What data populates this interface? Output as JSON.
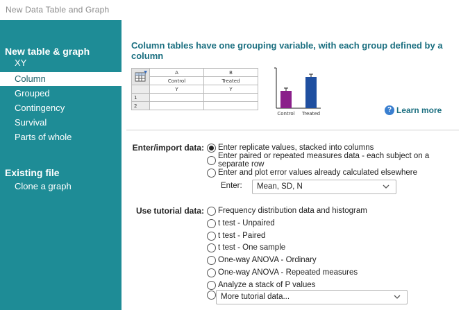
{
  "window": {
    "title": "New Data Table and Graph"
  },
  "sidebar": {
    "new_heading": "New table & graph",
    "items": [
      {
        "label": "XY",
        "selected": false
      },
      {
        "label": "Column",
        "selected": true
      },
      {
        "label": "Grouped",
        "selected": false
      },
      {
        "label": "Contingency",
        "selected": false
      },
      {
        "label": "Survival",
        "selected": false
      },
      {
        "label": "Parts of whole",
        "selected": false
      }
    ],
    "existing_heading": "Existing file",
    "existing_items": [
      {
        "label": "Clone a graph"
      }
    ]
  },
  "main": {
    "title": "Column tables have one grouping variable, with each group defined by a column",
    "preview": {
      "col_letters": [
        "A",
        "B"
      ],
      "col_names": [
        "Control",
        "Treated"
      ],
      "sub_headers": [
        "Y",
        "Y"
      ],
      "row_numbers": [
        "1",
        "2"
      ]
    },
    "mini_chart": {
      "categories": [
        "Control",
        "Treated"
      ],
      "values": [
        0.5,
        0.9
      ],
      "colors": [
        "#8a1f8a",
        "#1f4fa0"
      ]
    },
    "learn_more": "Learn more",
    "enter_import": {
      "label": "Enter/import data:",
      "options": [
        {
          "label": "Enter replicate values, stacked into columns",
          "selected": true
        },
        {
          "label": "Enter paired or repeated measures data - each subject on a separate row",
          "selected": false
        },
        {
          "label": "Enter and plot error values already calculated elsewhere",
          "selected": false
        }
      ],
      "enter_label": "Enter:",
      "enter_value": "Mean, SD, N"
    },
    "tutorial": {
      "label": "Use tutorial data:",
      "options": [
        {
          "label": "Frequency distribution data and histogram"
        },
        {
          "label": "t test - Unpaired"
        },
        {
          "label": "t test - Paired"
        },
        {
          "label": "t test - One sample"
        },
        {
          "label": "One-way ANOVA  - Ordinary"
        },
        {
          "label": "One-way ANOVA - Repeated measures"
        },
        {
          "label": "Analyze a stack of P values"
        }
      ],
      "more_value": "More tutorial data..."
    }
  }
}
